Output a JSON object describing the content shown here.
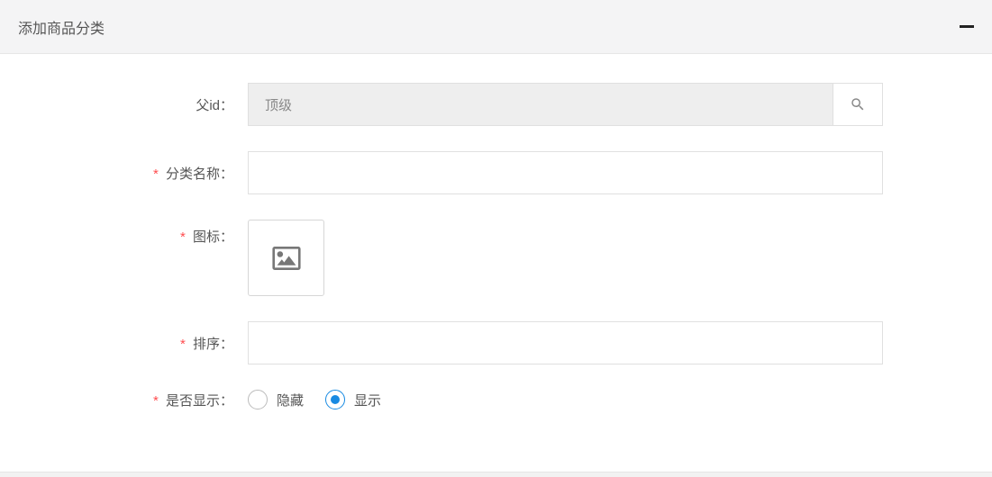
{
  "header": {
    "title": "添加商品分类"
  },
  "form": {
    "parent_id": {
      "label": "父id：",
      "value": "顶级"
    },
    "category_name": {
      "label": "分类名称：",
      "value": ""
    },
    "icon": {
      "label": "图标："
    },
    "sort": {
      "label": "排序：",
      "value": ""
    },
    "visible": {
      "label": "是否显示：",
      "options": {
        "hide": "隐藏",
        "show": "显示"
      },
      "selected": "show"
    }
  }
}
